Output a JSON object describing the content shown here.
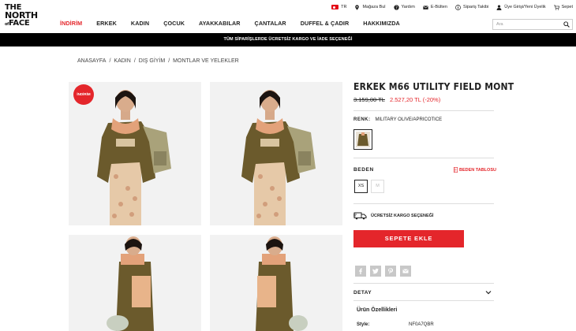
{
  "brand": {
    "line1": "THE",
    "line2": "NORTH",
    "line3": "FACE"
  },
  "utility": {
    "lang": "TR",
    "store": "Mağaza Bul",
    "help": "Yardım",
    "newsletter": "E-Bülten",
    "order": "Sipariş Takibi",
    "account": "Üye Girişi/Yeni Üyelik",
    "cart": "Sepet"
  },
  "nav": [
    "İNDİRİM",
    "ERKEK",
    "KADIN",
    "ÇOCUK",
    "AYAKKABILAR",
    "ÇANTALAR",
    "DUFFEL & ÇADIR",
    "HAKKIMIZDA"
  ],
  "search": {
    "placeholder": "Ara"
  },
  "promo": "TÜM SİPARİŞLERDE ÜCRETSİZ KARGO VE İADE SEÇENEĞİ",
  "breadcrumb": [
    "ANASAYFA",
    "/",
    "KADIN",
    "/",
    "DIŞ GİYİM",
    "/",
    "MONTLAR VE YELEKLER"
  ],
  "gallery": {
    "badge": "İNDİRİM"
  },
  "product": {
    "title": "ERKEK M66 UTILITY FIELD MONT",
    "old_price": "3.159,00 TL",
    "new_price": "2.527,20 TL (-20%)",
    "color_label": "RENK:",
    "color_value": "MILITARY OLIVE/APRICOTICE",
    "size_label": "BEDEN",
    "size_table": "BEDEN TABLOSU",
    "sizes": [
      "XS",
      "M"
    ],
    "shipping": "ÜCRETSİZ KARGO SEÇENEĞİ",
    "add_to_cart": "SEPETE EKLE",
    "detail_label": "DETAY",
    "features_title": "Ürün Özellikleri",
    "style_key": "Style:",
    "style_value": "NF0A7QBR"
  },
  "colors": {
    "accent": "#e4262b",
    "jacket": "#6b5a2c",
    "background": "#f2f2f2"
  },
  "icons": [
    "flag-tr-icon",
    "map-pin-icon",
    "help-icon",
    "mail-icon",
    "info-icon",
    "user-icon",
    "cart-icon",
    "search-icon",
    "ruler-icon",
    "truck-icon",
    "facebook-icon",
    "twitter-icon",
    "pinterest-icon",
    "email-share-icon",
    "chevron-down-icon"
  ]
}
